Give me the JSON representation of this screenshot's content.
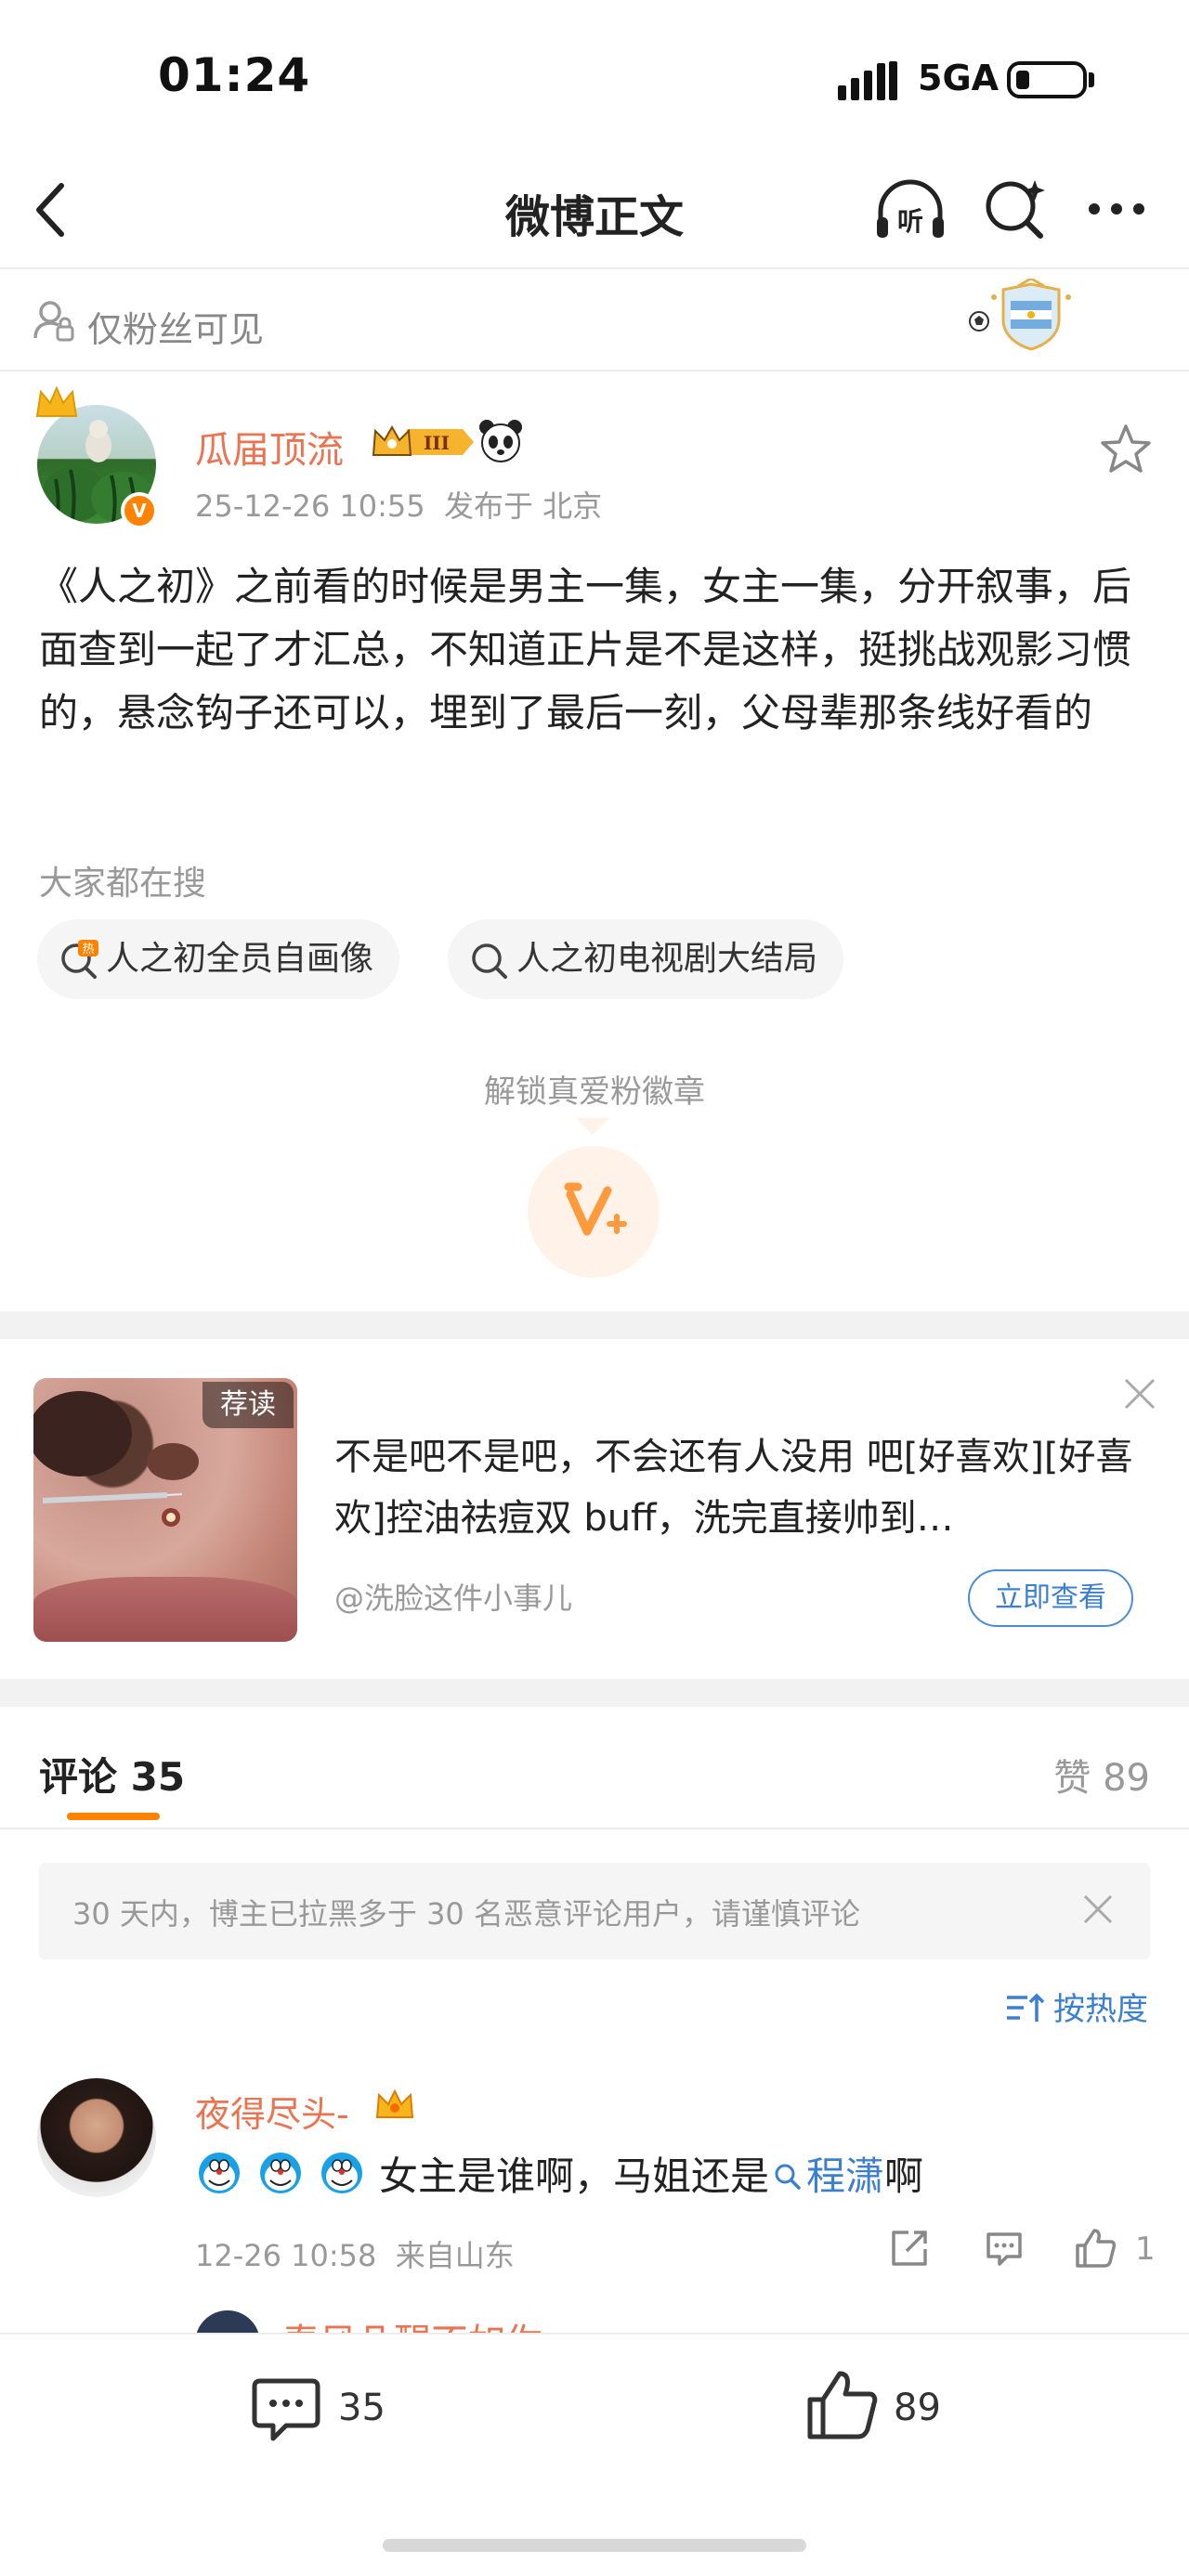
{
  "status_bar": {
    "time": "01:24",
    "network": "5GA"
  },
  "nav": {
    "title": "微博正文"
  },
  "visibility": {
    "label": "仅粉丝可见"
  },
  "post": {
    "author": "瓜届顶流",
    "time": "25-12-26 10:55",
    "location": "发布于 北京",
    "text": "《人之初》之前看的时候是男主一集，女主一集，分开叙事，后面查到一起了才汇总，不知道正片是不是这样，挺挑战观影习惯的，悬念钩子还可以，埋到了最后一刻，父母辈那条线好看的",
    "level_badge": "III"
  },
  "trending": {
    "label": "大家都在搜",
    "chips": [
      "人之初全员自画像",
      "人之初电视剧大结局"
    ],
    "hot_mark": "热"
  },
  "unlock": {
    "label": "解锁真爱粉徽章"
  },
  "ad": {
    "tag": "荐读",
    "text": "不是吧不是吧，不会还有人没用 吧[好喜欢][好喜欢]控油祛痘双 buff，洗完直接帅到…",
    "author": "@洗脸这件小事儿",
    "button": "立即查看"
  },
  "comments_header": {
    "comments_label": "评论 35",
    "likes_label": "赞 89"
  },
  "notice": {
    "text": "30 天内，博主已拉黑多于 30 名恶意评论用户，请谨慎评论"
  },
  "sort": {
    "label": "按热度"
  },
  "comment": {
    "author": "夜得尽头-",
    "text_before": "女主是谁啊，马姐还是",
    "link": "程潇",
    "text_after": "啊",
    "time": "12-26 10:58",
    "location": "来自山东",
    "likes": "1"
  },
  "reply_peek": {
    "author": "春风几醒不如你"
  },
  "bottom_bar": {
    "comments": "35",
    "likes": "89"
  },
  "colors": {
    "accent_orange": "#ff8200",
    "username": "#eb7350",
    "link_blue": "#3b7fd0"
  }
}
